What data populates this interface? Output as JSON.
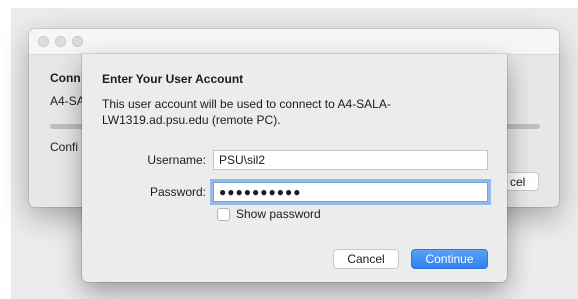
{
  "background_window": {
    "title": "Conn",
    "subtitle": "A4-SA",
    "status": "Confi",
    "cancel_label": "cel"
  },
  "dialog": {
    "title": "Enter Your User Account",
    "message": "This user account will be used to connect to A4-SALA-LW1319.ad.psu.edu (remote PC).",
    "username_label": "Username:",
    "username_value": "PSU\\sil2",
    "password_label": "Password:",
    "password_value": "●●●●●●●●●●",
    "show_password_label": "Show password",
    "show_password_checked": false,
    "cancel_label": "Cancel",
    "continue_label": "Continue"
  },
  "colors": {
    "accent": "#2f82ee",
    "focus_ring": "#5491e2"
  }
}
